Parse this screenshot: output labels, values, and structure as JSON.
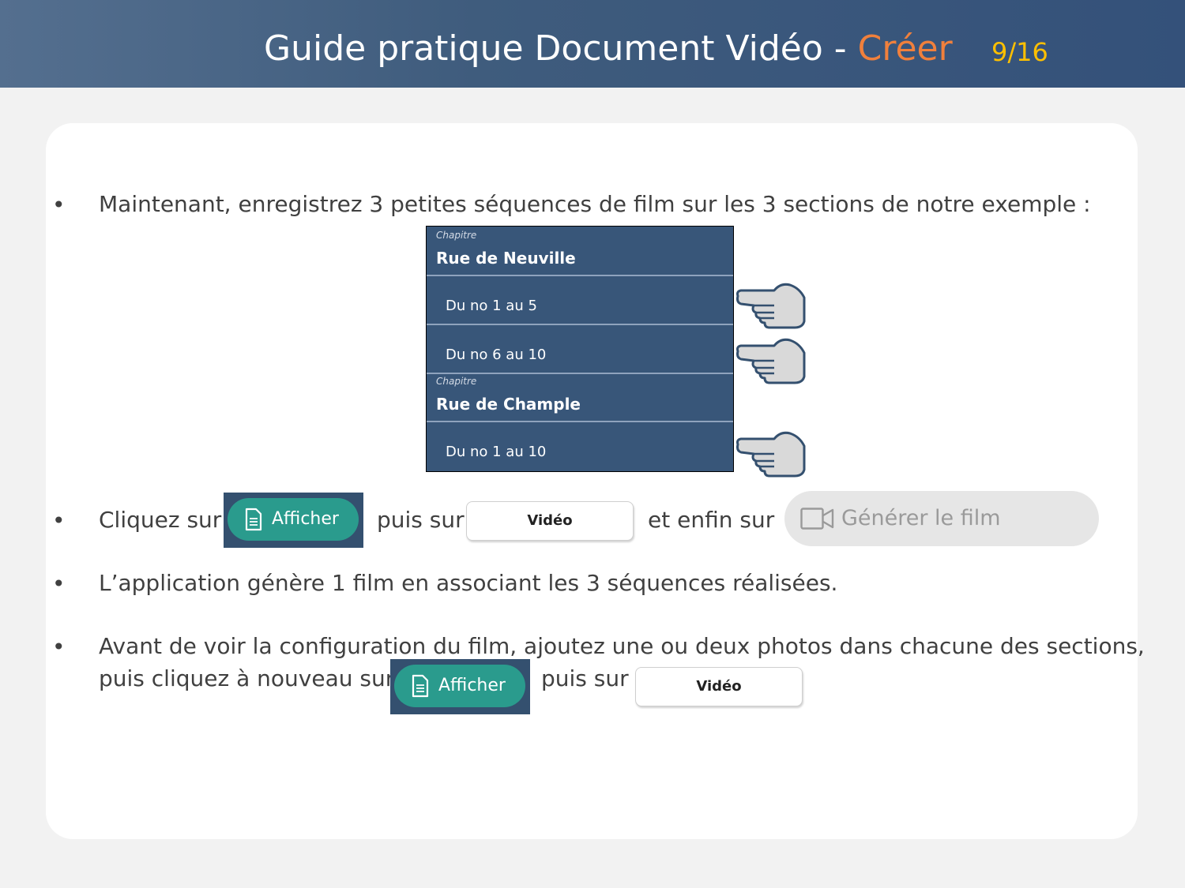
{
  "header": {
    "title_prefix": "Guide pratique Document Vidéo - ",
    "title_accent": "Créer",
    "page_indicator": "9/16"
  },
  "bullets": {
    "b1": "Maintenant, enregistrez 3 petites séquences de film sur les 3 sections de notre exemple :",
    "b2_part1": "Cliquez sur",
    "b2_part2": "puis sur",
    "b2_part3": "et enfin sur",
    "b3": "L’application génère 1 film en associant les 3 séquences réalisées.",
    "b4_line1": "Avant de voir la configuration du film, ajoutez une ou deux photos dans chacune des sections,",
    "b4_line2a": "puis cliquez à nouveau sur",
    "b4_line2b": "puis sur"
  },
  "snippet": {
    "chapters": [
      {
        "label": "Chapitre",
        "title": "Rue de Neuville",
        "rows": [
          "Du no 1 au 5",
          "Du no 6 au 10"
        ]
      },
      {
        "label": "Chapitre",
        "title": "Rue de Chample",
        "rows": [
          "Du no 1 au 10"
        ]
      }
    ]
  },
  "buttons": {
    "afficher_label": "Afficher",
    "video_label": "Vidéo",
    "generate_label": "Générer le film"
  },
  "colors": {
    "header_bg": "#3f5c7d",
    "accent": "#f0803c",
    "page_indicator": "#ffc000",
    "afficher_bg": "#2a9b8d",
    "snippet_bg": "#385679"
  }
}
